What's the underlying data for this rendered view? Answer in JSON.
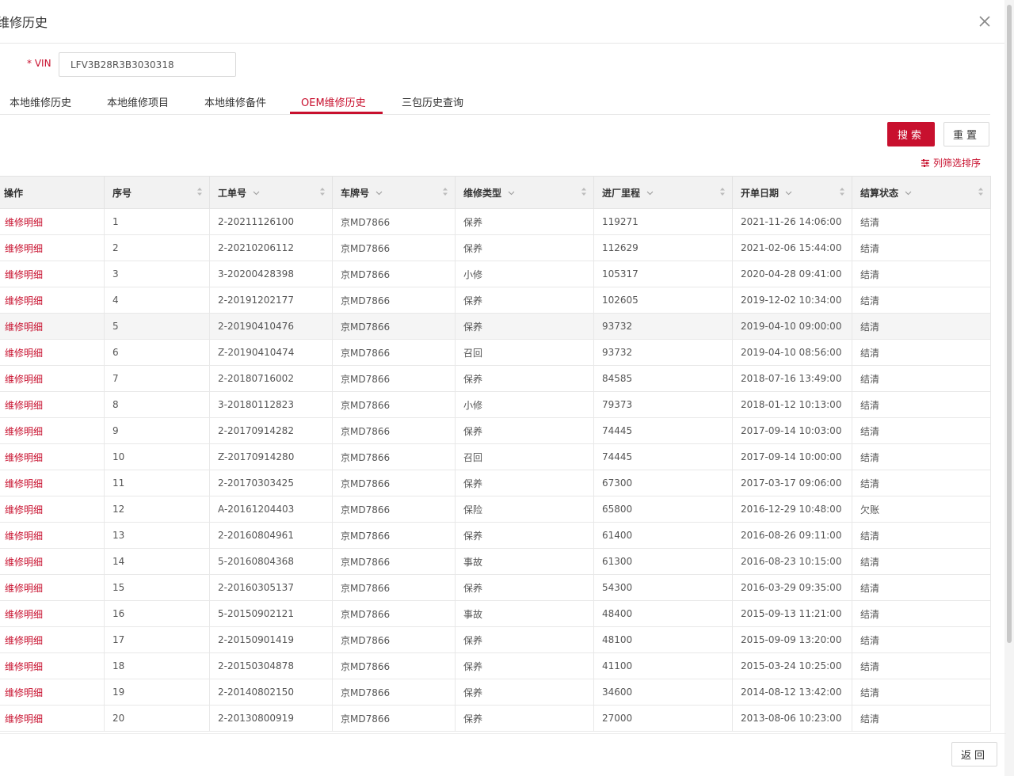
{
  "dialog": {
    "title": "维修历史"
  },
  "vin": {
    "required_mark": "*",
    "label": "VIN",
    "value": "LFV3B28R3B3030318"
  },
  "tabs": [
    {
      "label": "本地维修历史",
      "active": false
    },
    {
      "label": "本地维修项目",
      "active": false
    },
    {
      "label": "本地维修备件",
      "active": false
    },
    {
      "label": "OEM维修历史",
      "active": true
    },
    {
      "label": "三包历史查询",
      "active": false
    }
  ],
  "toolbar": {
    "search_label": "搜索",
    "reset_label": "重置",
    "column_filter_label": "列筛选排序"
  },
  "table": {
    "headers": [
      "操作",
      "序号",
      "工单号",
      "车牌号",
      "维修类型",
      "进厂里程",
      "开单日期",
      "结算状态"
    ],
    "action_label": "维修明细",
    "rows": [
      {
        "no": "1",
        "order": "2-20211126100",
        "plate": "京MD7866",
        "type": "保养",
        "mileage": "119271",
        "date": "2021-11-26 14:06:00",
        "status": "结清"
      },
      {
        "no": "2",
        "order": "2-20210206112",
        "plate": "京MD7866",
        "type": "保养",
        "mileage": "112629",
        "date": "2021-02-06 15:44:00",
        "status": "结清"
      },
      {
        "no": "3",
        "order": "3-20200428398",
        "plate": "京MD7866",
        "type": "小修",
        "mileage": "105317",
        "date": "2020-04-28 09:41:00",
        "status": "结清"
      },
      {
        "no": "4",
        "order": "2-20191202177",
        "plate": "京MD7866",
        "type": "保养",
        "mileage": "102605",
        "date": "2019-12-02 10:34:00",
        "status": "结清"
      },
      {
        "no": "5",
        "order": "2-20190410476",
        "plate": "京MD7866",
        "type": "保养",
        "mileage": "93732",
        "date": "2019-04-10 09:00:00",
        "status": "结清"
      },
      {
        "no": "6",
        "order": "Z-20190410474",
        "plate": "京MD7866",
        "type": "召回",
        "mileage": "93732",
        "date": "2019-04-10 08:56:00",
        "status": "结清"
      },
      {
        "no": "7",
        "order": "2-20180716002",
        "plate": "京MD7866",
        "type": "保养",
        "mileage": "84585",
        "date": "2018-07-16 13:49:00",
        "status": "结清"
      },
      {
        "no": "8",
        "order": "3-20180112823",
        "plate": "京MD7866",
        "type": "小修",
        "mileage": "79373",
        "date": "2018-01-12 10:13:00",
        "status": "结清"
      },
      {
        "no": "9",
        "order": "2-20170914282",
        "plate": "京MD7866",
        "type": "保养",
        "mileage": "74445",
        "date": "2017-09-14 10:03:00",
        "status": "结清"
      },
      {
        "no": "10",
        "order": "Z-20170914280",
        "plate": "京MD7866",
        "type": "召回",
        "mileage": "74445",
        "date": "2017-09-14 10:00:00",
        "status": "结清"
      },
      {
        "no": "11",
        "order": "2-20170303425",
        "plate": "京MD7866",
        "type": "保养",
        "mileage": "67300",
        "date": "2017-03-17 09:06:00",
        "status": "结清"
      },
      {
        "no": "12",
        "order": "A-20161204403",
        "plate": "京MD7866",
        "type": "保险",
        "mileage": "65800",
        "date": "2016-12-29 10:48:00",
        "status": "欠账"
      },
      {
        "no": "13",
        "order": "2-20160804961",
        "plate": "京MD7866",
        "type": "保养",
        "mileage": "61400",
        "date": "2016-08-26 09:11:00",
        "status": "结清"
      },
      {
        "no": "14",
        "order": "5-20160804368",
        "plate": "京MD7866",
        "type": "事故",
        "mileage": "61300",
        "date": "2016-08-23 10:15:00",
        "status": "结清"
      },
      {
        "no": "15",
        "order": "2-20160305137",
        "plate": "京MD7866",
        "type": "保养",
        "mileage": "54300",
        "date": "2016-03-29 09:35:00",
        "status": "结清"
      },
      {
        "no": "16",
        "order": "5-20150902121",
        "plate": "京MD7866",
        "type": "事故",
        "mileage": "48400",
        "date": "2015-09-13 11:21:00",
        "status": "结清"
      },
      {
        "no": "17",
        "order": "2-20150901419",
        "plate": "京MD7866",
        "type": "保养",
        "mileage": "48100",
        "date": "2015-09-09 13:20:00",
        "status": "结清"
      },
      {
        "no": "18",
        "order": "2-20150304878",
        "plate": "京MD7866",
        "type": "保养",
        "mileage": "41100",
        "date": "2015-03-24 10:25:00",
        "status": "结清"
      },
      {
        "no": "19",
        "order": "2-20140802150",
        "plate": "京MD7866",
        "type": "保养",
        "mileage": "34600",
        "date": "2014-08-12 13:42:00",
        "status": "结清"
      },
      {
        "no": "20",
        "order": "2-20130800919",
        "plate": "京MD7866",
        "type": "保养",
        "mileage": "27000",
        "date": "2013-08-06 10:23:00",
        "status": "结清"
      }
    ]
  },
  "footer": {
    "back_label": "返回"
  },
  "colors": {
    "accent": "#c8102e",
    "header_bg": "#f2f2f2",
    "border": "#e3e3e3"
  },
  "icons": {
    "close": "close-icon",
    "sort": "sort-icon",
    "dropdown": "chevron-down-icon",
    "filter": "filter-icon"
  }
}
